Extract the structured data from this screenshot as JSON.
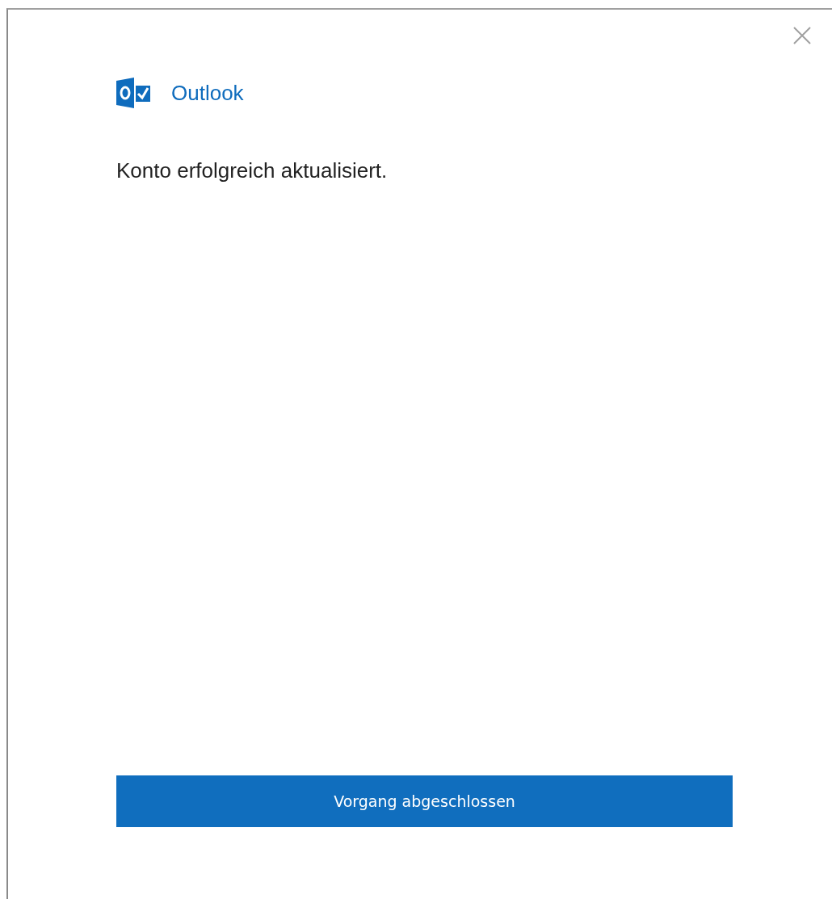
{
  "dialog": {
    "app_name": "Outlook",
    "message": "Konto erfolgreich aktualisiert.",
    "button": "Vorgang abgeschlossen"
  }
}
